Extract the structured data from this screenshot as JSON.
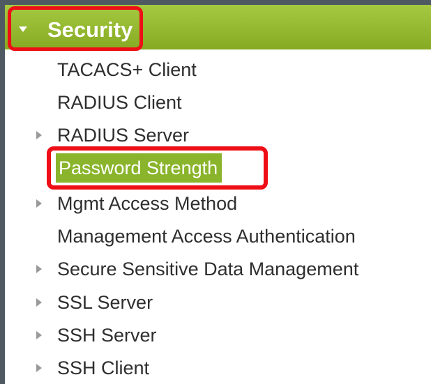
{
  "nav": {
    "section": {
      "title": "Security",
      "expanded": true
    },
    "items": [
      {
        "label": "TACACS+ Client",
        "expandable": false,
        "selected": false
      },
      {
        "label": "RADIUS Client",
        "expandable": false,
        "selected": false
      },
      {
        "label": "RADIUS Server",
        "expandable": true,
        "selected": false
      },
      {
        "label": "Password Strength",
        "expandable": false,
        "selected": true
      },
      {
        "label": "Mgmt Access Method",
        "expandable": true,
        "selected": false
      },
      {
        "label": "Management Access Authentication",
        "expandable": false,
        "selected": false
      },
      {
        "label": "Secure Sensitive Data Management",
        "expandable": true,
        "selected": false
      },
      {
        "label": "SSL Server",
        "expandable": true,
        "selected": false
      },
      {
        "label": "SSH Server",
        "expandable": true,
        "selected": false
      },
      {
        "label": "SSH Client",
        "expandable": true,
        "selected": false
      }
    ]
  },
  "colors": {
    "header_green": "#97bb2e",
    "selected_green": "#8ab42b",
    "highlight_red": "#ee0e16",
    "text": "#2e2e2e",
    "arrow_gray": "#9a9a9a",
    "border_dark": "#4f5962"
  },
  "icons": {
    "section_toggle": "triangle-down-icon",
    "item_expand": "triangle-right-icon"
  }
}
